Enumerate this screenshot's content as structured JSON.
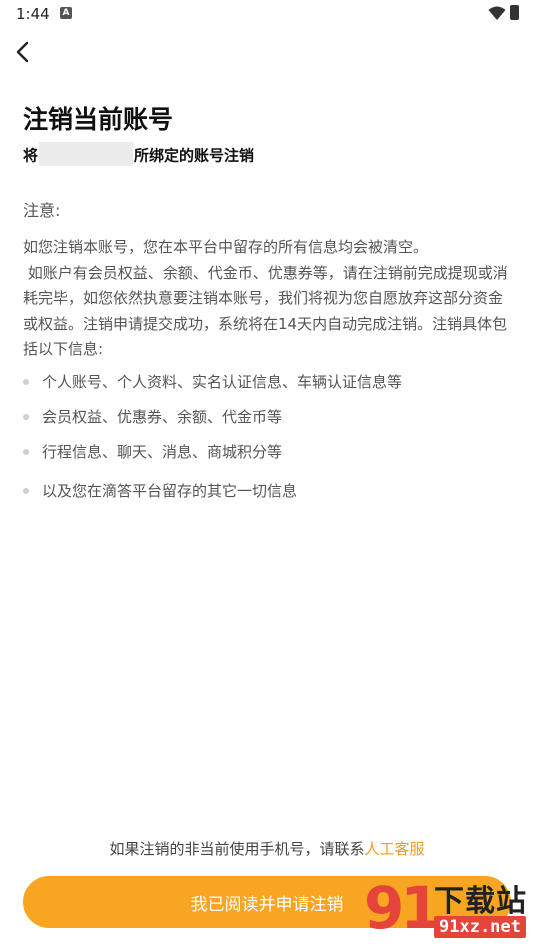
{
  "status_bar": {
    "time": "1:44",
    "notification_icon": "a-notification-icon",
    "wifi_icon": "wifi-icon",
    "battery_icon": "battery-charging-icon"
  },
  "nav": {
    "back_icon": "chevron-left-icon"
  },
  "header": {
    "title": "注销当前账号",
    "subtitle_prefix": "将",
    "subtitle_suffix": "所绑定的账号注销"
  },
  "notice": {
    "label": "注意:",
    "paragraph": "如您注销本账号，您在本平台中留存的所有信息均会被清空。\n 如账户有会员权益、余额、代金币、优惠券等，请在注销前完成提现或消耗完毕，如您依然执意要注销本账号，我们将视为您自愿放弃这部分资金或权益。注销申请提交成功，系统将在14天内自动完成注销。注销具体包括以下信息:",
    "items": [
      "个人账号、个人资料、实名认证信息、车辆认证信息等",
      "会员权益、优惠券、余额、代金币等",
      "行程信息、聊天、消息、商城积分等",
      "以及您在滴答平台留存的其它一切信息"
    ]
  },
  "footer": {
    "contact_text": "如果注销的非当前使用手机号，请联系",
    "contact_link": "人工客服",
    "apply_button": "我已阅读并申请注销"
  },
  "watermark": {
    "number": "91",
    "title": "下载站",
    "domain": "91xz.net"
  },
  "colors": {
    "accent": "#f8a521",
    "link": "#f39a1d",
    "watermark_red": "#e4443a"
  }
}
